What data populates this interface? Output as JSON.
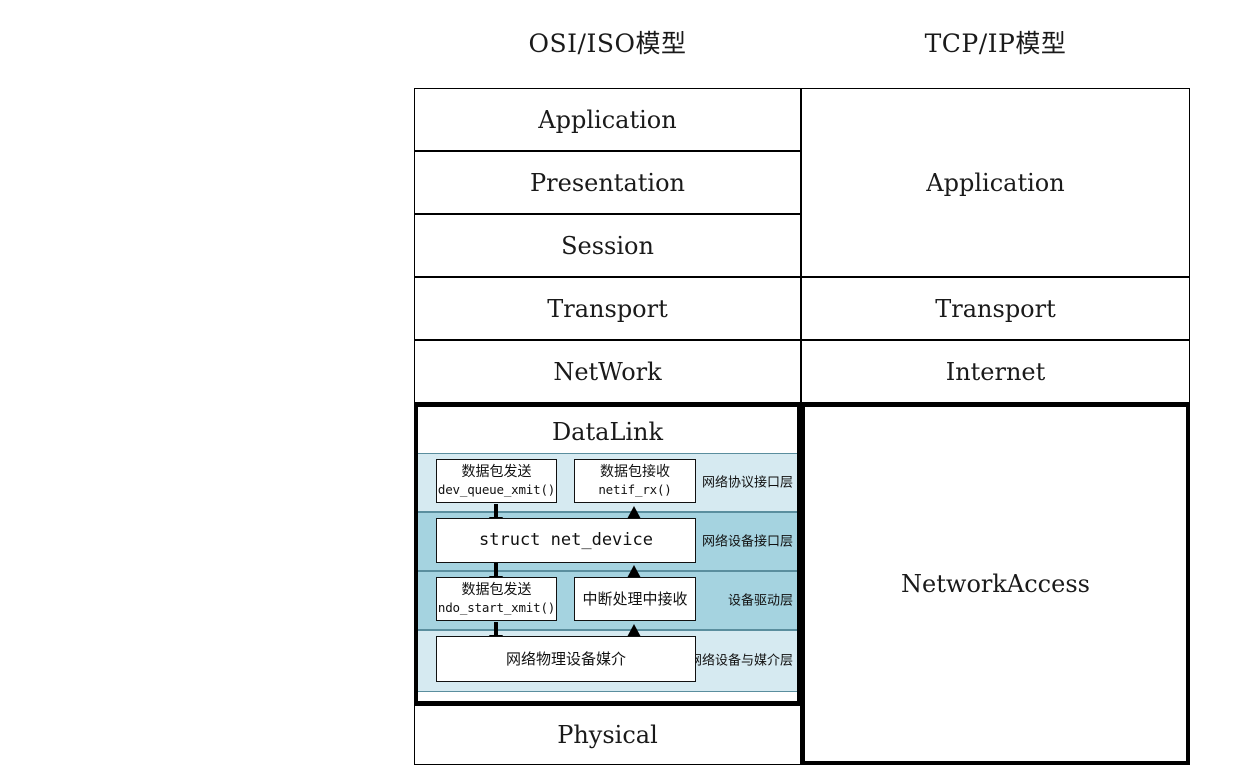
{
  "titles": {
    "osi": "OSI/ISO模型",
    "tcp": "TCP/IP模型"
  },
  "colors": {
    "band_light": "#d6eaf1",
    "band_dark": "#a5d3e0",
    "border": "#000000",
    "band_border": "#5a8e9e",
    "background": "#ffffff"
  },
  "osi_layers": [
    {
      "label": "Application"
    },
    {
      "label": "Presentation"
    },
    {
      "label": "Session"
    },
    {
      "label": "Transport"
    },
    {
      "label": "NetWork"
    },
    {
      "label": "DataLink"
    },
    {
      "label": "Physical"
    }
  ],
  "tcp_layers": [
    {
      "label": "Application"
    },
    {
      "label": "Transport"
    },
    {
      "label": "Internet"
    },
    {
      "label": "NetworkAccess"
    }
  ],
  "datalink_detail": {
    "bands": [
      {
        "label": "网络协议接口层",
        "shade": "light"
      },
      {
        "label": "网络设备接口层",
        "shade": "dark"
      },
      {
        "label": "设备驱动层",
        "shade": "dark"
      },
      {
        "label": "网络设备与媒介层",
        "shade": "light"
      }
    ],
    "boxes": {
      "tx_protocol_title": "数据包发送",
      "tx_protocol_func": "dev_queue_xmit()",
      "rx_protocol_title": "数据包接收",
      "rx_protocol_func": "netif_rx()",
      "net_device": "struct net_device",
      "tx_driver_title": "数据包发送",
      "tx_driver_func": "ndo_start_xmit()",
      "rx_driver_title": "中断处理中接收",
      "media": "网络物理设备媒介"
    },
    "arrows": {
      "tx_direction": "down",
      "rx_direction": "up"
    }
  }
}
